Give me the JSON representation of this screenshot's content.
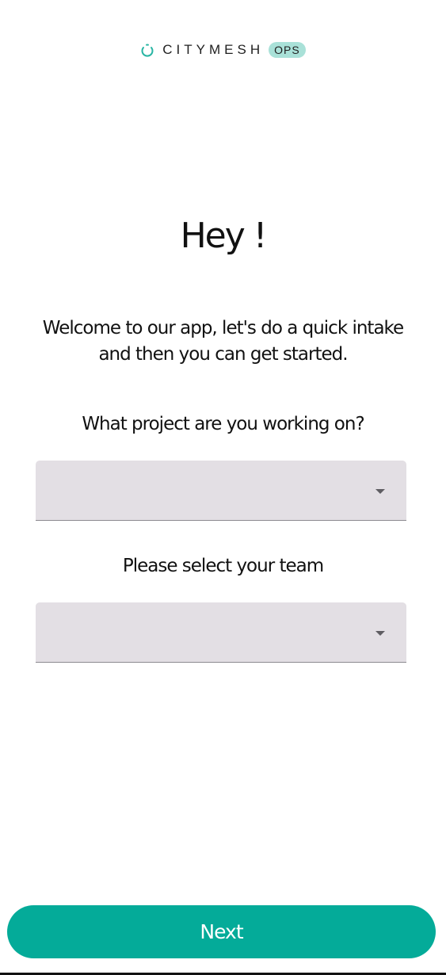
{
  "logo": {
    "brand": "CITYMESH",
    "badge": "OPS",
    "accent_color": "#29b5a4",
    "icon": "citymesh-ring-icon"
  },
  "greeting": "Hey !",
  "intro": "Welcome to our app, let's do a quick intake and then you can get started.",
  "project_field": {
    "question": "What project are you working on?",
    "value": ""
  },
  "team_field": {
    "question": "Please select your team",
    "value": ""
  },
  "next_button": {
    "label": "Next",
    "color": "#04ab99"
  }
}
